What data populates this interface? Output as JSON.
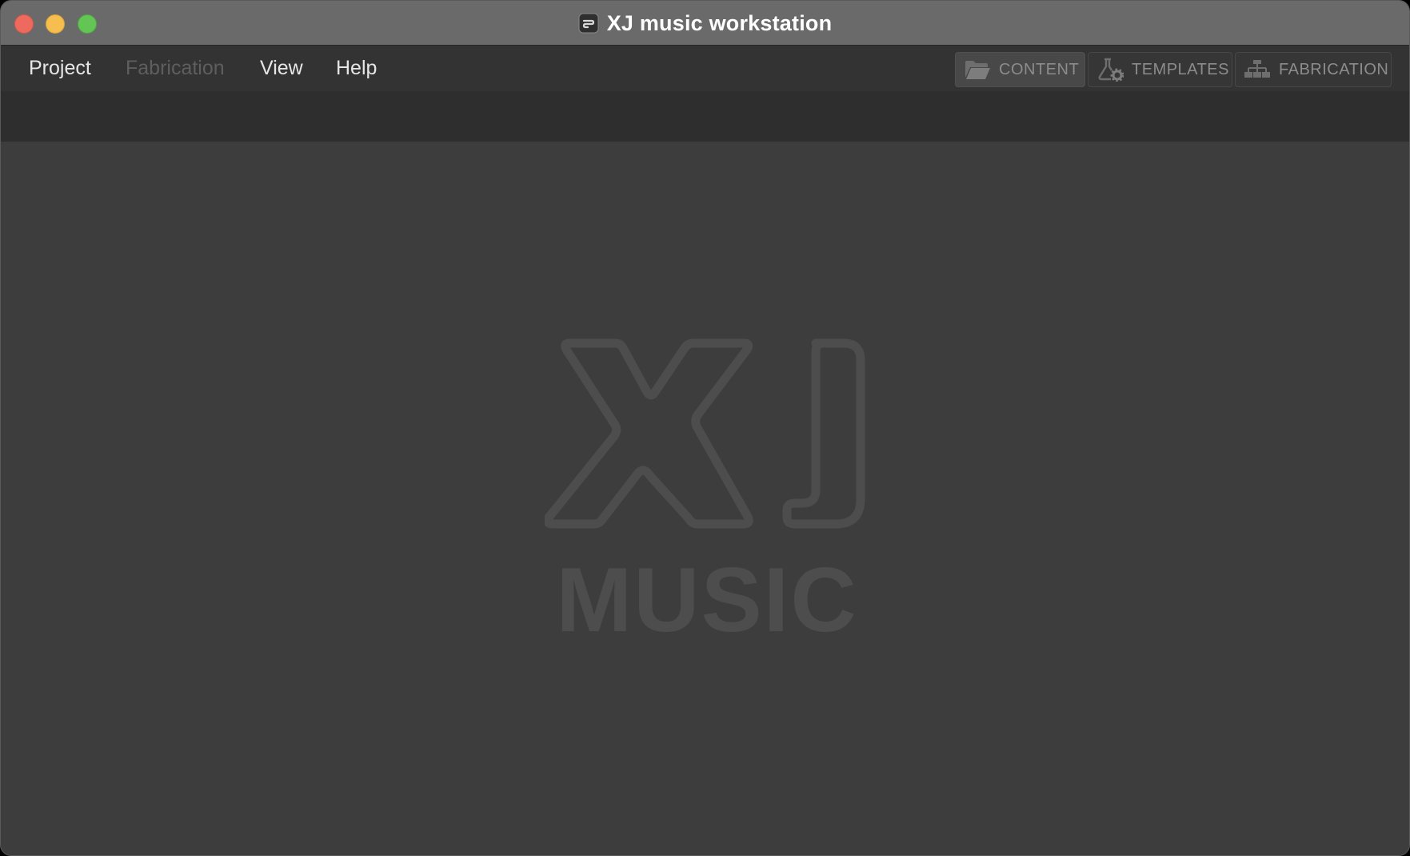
{
  "window": {
    "title": "XJ music workstation"
  },
  "traffic_lights": {
    "close": "close-button",
    "minimize": "minimize-button",
    "zoom": "zoom-button"
  },
  "menu": {
    "items": [
      {
        "label": "Project",
        "enabled": true
      },
      {
        "label": "Fabrication",
        "enabled": false
      },
      {
        "label": "View",
        "enabled": true
      },
      {
        "label": "Help",
        "enabled": true
      }
    ]
  },
  "nav": {
    "buttons": [
      {
        "label": "CONTENT",
        "icon": "folder-icon",
        "active": true
      },
      {
        "label": "TEMPLATES",
        "icon": "flask-gear-icon",
        "active": false
      },
      {
        "label": "FABRICATION",
        "icon": "hierarchy-icon",
        "active": false
      }
    ]
  },
  "logo": {
    "mark": "XJ",
    "wordmark": "MUSIC"
  },
  "colors": {
    "titlebar": "#6a6a6a",
    "menubar": "#333333",
    "toolbar": "#2e2e2e",
    "content": "#3d3d3d",
    "logo": "#4d4d4d",
    "menu_text": "#e6e6e6",
    "menu_disabled": "#5e5e5e",
    "nav_text": "#8c8c8c"
  }
}
